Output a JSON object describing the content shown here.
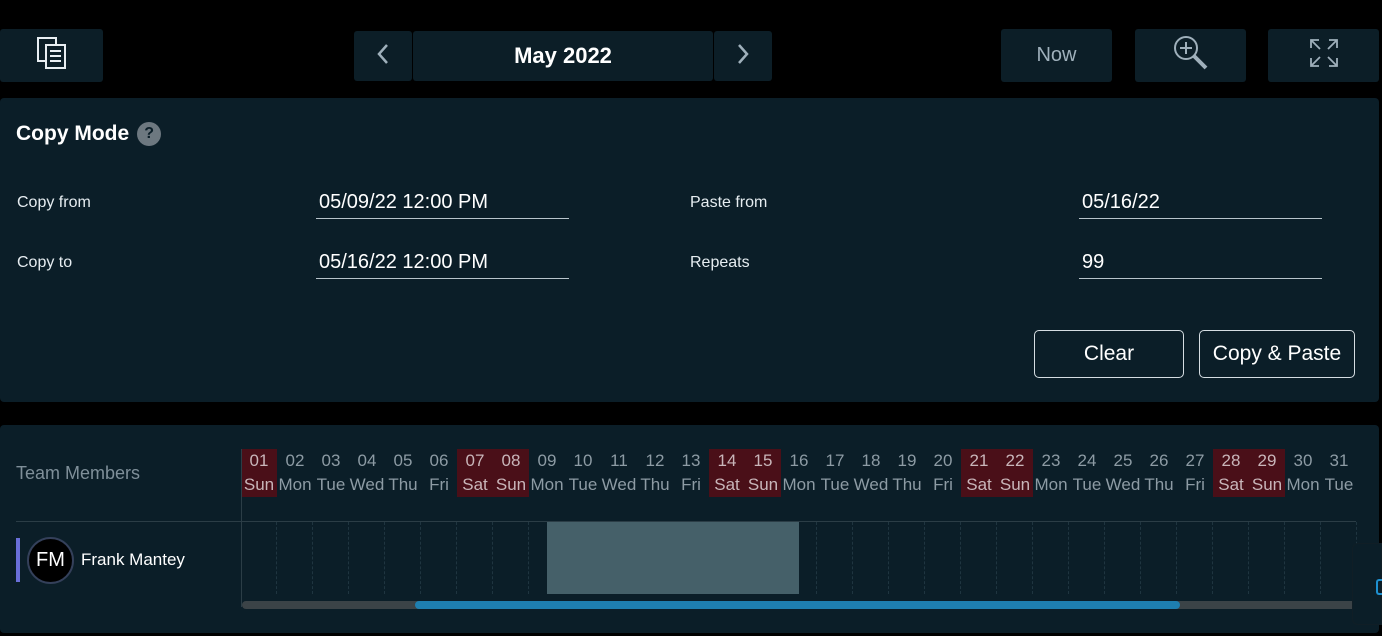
{
  "toolbar": {
    "month_title": "May 2022",
    "now_label": "Now"
  },
  "copy_mode": {
    "title": "Copy Mode",
    "help_icon": "?",
    "copy_from_label": "Copy from",
    "copy_from_value": "05/09/22 12:00 PM",
    "copy_to_label": "Copy to",
    "copy_to_value": "05/16/22 12:00 PM",
    "paste_from_label": "Paste from",
    "paste_from_value": "05/16/22",
    "repeats_label": "Repeats",
    "repeats_value": "99",
    "clear_label": "Clear",
    "copy_paste_label": "Copy & Paste"
  },
  "timeline": {
    "team_members_label": "Team Members",
    "days": [
      {
        "num": "01",
        "dow": "Sun",
        "weekend": true
      },
      {
        "num": "02",
        "dow": "Mon",
        "weekend": false
      },
      {
        "num": "03",
        "dow": "Tue",
        "weekend": false
      },
      {
        "num": "04",
        "dow": "Wed",
        "weekend": false
      },
      {
        "num": "05",
        "dow": "Thu",
        "weekend": false
      },
      {
        "num": "06",
        "dow": "Fri",
        "weekend": false
      },
      {
        "num": "07",
        "dow": "Sat",
        "weekend": true
      },
      {
        "num": "08",
        "dow": "Sun",
        "weekend": true
      },
      {
        "num": "09",
        "dow": "Mon",
        "weekend": false
      },
      {
        "num": "10",
        "dow": "Tue",
        "weekend": false
      },
      {
        "num": "11",
        "dow": "Wed",
        "weekend": false
      },
      {
        "num": "12",
        "dow": "Thu",
        "weekend": false
      },
      {
        "num": "13",
        "dow": "Fri",
        "weekend": false
      },
      {
        "num": "14",
        "dow": "Sat",
        "weekend": true
      },
      {
        "num": "15",
        "dow": "Sun",
        "weekend": true
      },
      {
        "num": "16",
        "dow": "Mon",
        "weekend": false
      },
      {
        "num": "17",
        "dow": "Tue",
        "weekend": false
      },
      {
        "num": "18",
        "dow": "Wed",
        "weekend": false
      },
      {
        "num": "19",
        "dow": "Thu",
        "weekend": false
      },
      {
        "num": "20",
        "dow": "Fri",
        "weekend": false
      },
      {
        "num": "21",
        "dow": "Sat",
        "weekend": true
      },
      {
        "num": "22",
        "dow": "Sun",
        "weekend": true
      },
      {
        "num": "23",
        "dow": "Mon",
        "weekend": false
      },
      {
        "num": "24",
        "dow": "Tue",
        "weekend": false
      },
      {
        "num": "25",
        "dow": "Wed",
        "weekend": false
      },
      {
        "num": "26",
        "dow": "Thu",
        "weekend": false
      },
      {
        "num": "27",
        "dow": "Fri",
        "weekend": false
      },
      {
        "num": "28",
        "dow": "Sat",
        "weekend": true
      },
      {
        "num": "29",
        "dow": "Sun",
        "weekend": true
      },
      {
        "num": "30",
        "dow": "Mon",
        "weekend": false
      },
      {
        "num": "31",
        "dow": "Tue",
        "weekend": false
      }
    ],
    "members": [
      {
        "initials": "FM",
        "name": "Frank Mantey"
      }
    ]
  },
  "icons": {
    "copy": "copy-icon",
    "prev": "chevron-left-icon",
    "next": "chevron-right-icon",
    "zoom": "zoom-in-icon",
    "fullscreen": "fullscreen-icon"
  },
  "colors": {
    "panel_bg": "#0b1e28",
    "weekend_bg": "#4a0f18",
    "selection": "#456069",
    "scroll_thumb": "#1e7fb0",
    "member_accent": "#6a6fd8"
  }
}
